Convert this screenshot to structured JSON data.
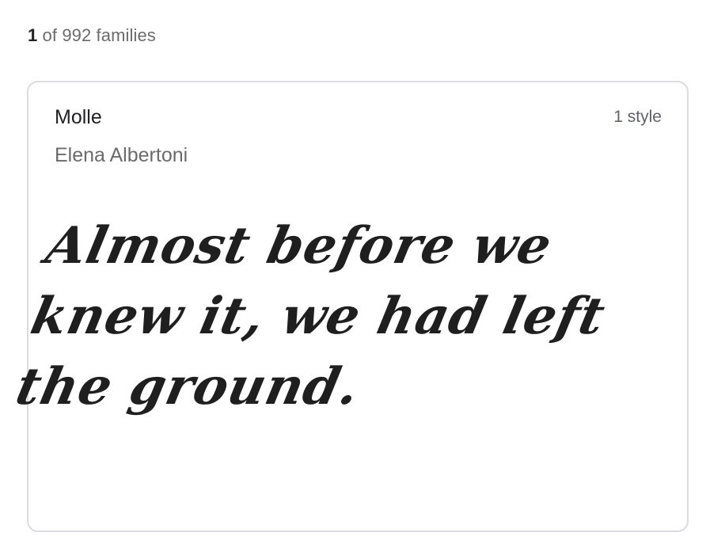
{
  "results": {
    "current": "1",
    "suffix": " of 992 families"
  },
  "card": {
    "family_name": "Molle",
    "style_count": "1 style",
    "designer": "Elena Albertoni",
    "preview_text": "Almost before we knew it, we had left the ground."
  }
}
